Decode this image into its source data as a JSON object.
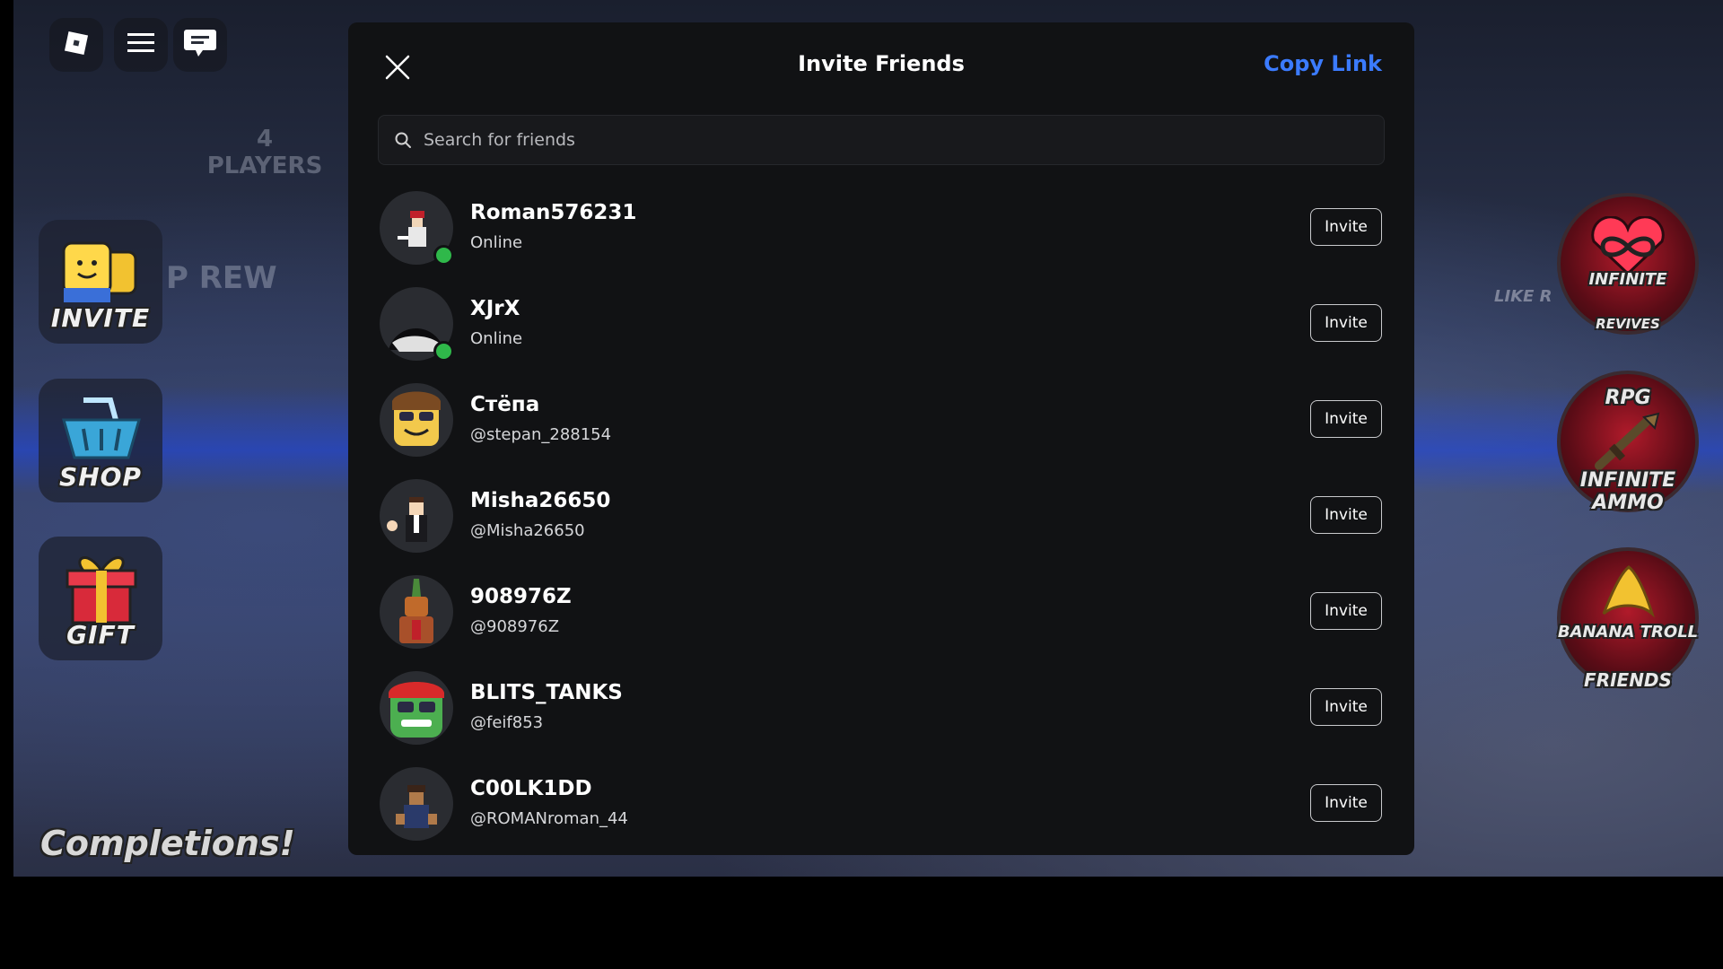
{
  "topbar": {
    "roblox_icon": "roblox-logo-icon",
    "menu_icon": "hamburger-menu-icon",
    "chat_icon": "chat-icon"
  },
  "game": {
    "players_hint_count": "4",
    "players_hint_label": "PLAYERS",
    "reward_hint": "P REW",
    "side_buttons": [
      {
        "label": "INVITE",
        "icon": "invite-friends-icon"
      },
      {
        "label": "SHOP",
        "icon": "shop-basket-icon"
      },
      {
        "label": "GIFT",
        "icon": "gift-icon"
      }
    ],
    "completions_text": "Completions!",
    "like_hint": "LIKE R",
    "right_buttons": [
      {
        "label_top": "INFINITE",
        "label_bottom": "REVIVES",
        "icon": "infinity-heart-icon"
      },
      {
        "label_top": "RPG",
        "label_bottom": "INFINITE AMMO",
        "icon": "rpg-icon"
      },
      {
        "label_top": "BANANA TROLL",
        "label_bottom": "FRIENDS",
        "icon": "banana-icon"
      }
    ]
  },
  "panel": {
    "title": "Invite Friends",
    "copy_link": "Copy Link",
    "search_placeholder": "Search for friends",
    "invite_label": "Invite",
    "friends": [
      {
        "name": "Roman576231",
        "sub": "Online",
        "online": true,
        "avatar_color": "#e8e8e8"
      },
      {
        "name": "XJrX",
        "sub": "Online",
        "online": true,
        "avatar_color": "#d0d0d0"
      },
      {
        "name": "Стёпа",
        "sub": "@stepan_288154",
        "online": false,
        "avatar_color": "#f2c94c"
      },
      {
        "name": "Misha26650",
        "sub": "@Misha26650",
        "online": false,
        "avatar_color": "#f5d7b8"
      },
      {
        "name": "908976Z",
        "sub": "@908976Z",
        "online": false,
        "avatar_color": "#c06a2b"
      },
      {
        "name": "BLITS_TANKS",
        "sub": "@feif853",
        "online": false,
        "avatar_color": "#4caf50"
      },
      {
        "name": "C00LK1DD",
        "sub": "@ROMANroman_44",
        "online": false,
        "avatar_color": "#b07a4a"
      }
    ]
  },
  "colors": {
    "panel_bg": "#111214",
    "accent_link": "#3b7bff",
    "online_dot": "#2fb84a"
  }
}
